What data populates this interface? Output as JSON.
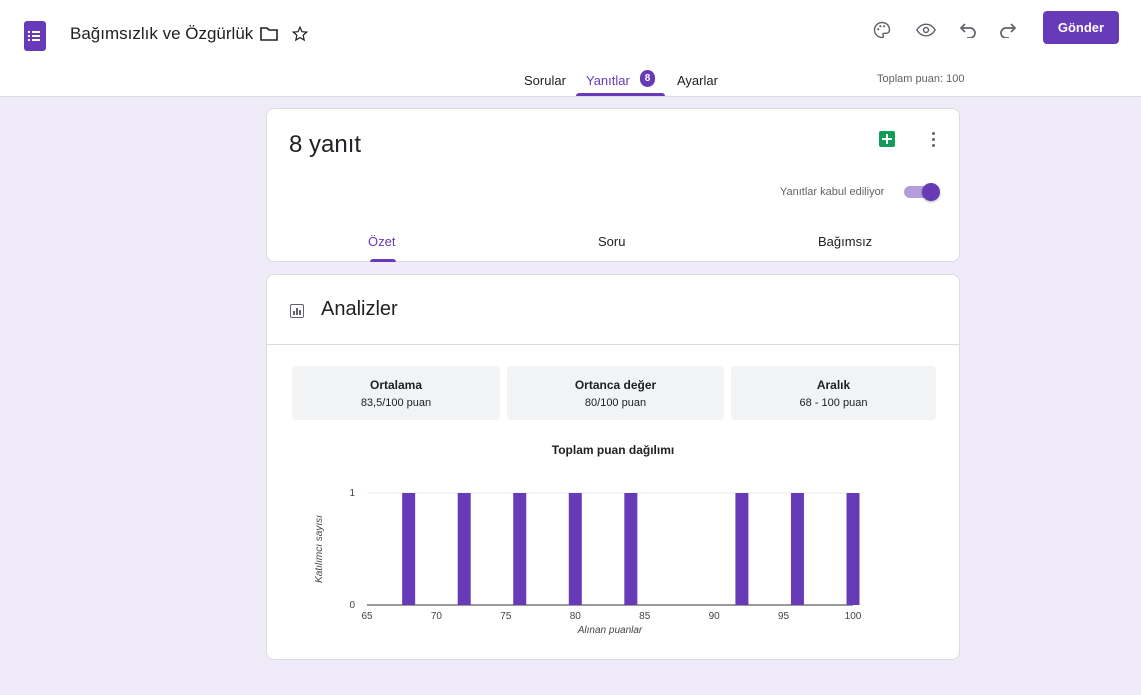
{
  "header": {
    "title": "Bağımsızlık ve Özgürlük",
    "send_label": "Gönder",
    "tabs": [
      {
        "label": "Sorular"
      },
      {
        "label": "Yanıtlar",
        "badge": "8"
      },
      {
        "label": "Ayarlar"
      }
    ],
    "total_points": "Toplam puan: 100",
    "accent": "#673ab7"
  },
  "summary": {
    "count_label": "8 yanıt",
    "accepting_label": "Yanıtlar kabul ediliyor",
    "accepting": true,
    "subtabs": [
      {
        "label": "Özet"
      },
      {
        "label": "Soru"
      },
      {
        "label": "Bağımsız"
      }
    ]
  },
  "analytics": {
    "title": "Analizler",
    "stats": [
      {
        "label": "Ortalama",
        "value": "83,5/100 puan"
      },
      {
        "label": "Ortanca değer",
        "value": "80/100 puan"
      },
      {
        "label": "Aralık",
        "value": "68 - 100 puan"
      }
    ]
  },
  "chart_data": {
    "type": "bar",
    "title": "Toplam puan dağılımı",
    "xlabel": "Alınan puanlar",
    "ylabel": "Katılımcı sayısı",
    "x": [
      68,
      72,
      76,
      80,
      84,
      92,
      96,
      100
    ],
    "values": [
      1,
      1,
      1,
      1,
      1,
      1,
      1,
      1
    ],
    "xlim": [
      65,
      100
    ],
    "ylim": [
      0,
      1
    ],
    "xticks": [
      "65",
      "70",
      "75",
      "80",
      "85",
      "90",
      "95",
      "100"
    ],
    "yticks": [
      "0",
      "1"
    ],
    "color": "#673ab7",
    "grid": true
  }
}
